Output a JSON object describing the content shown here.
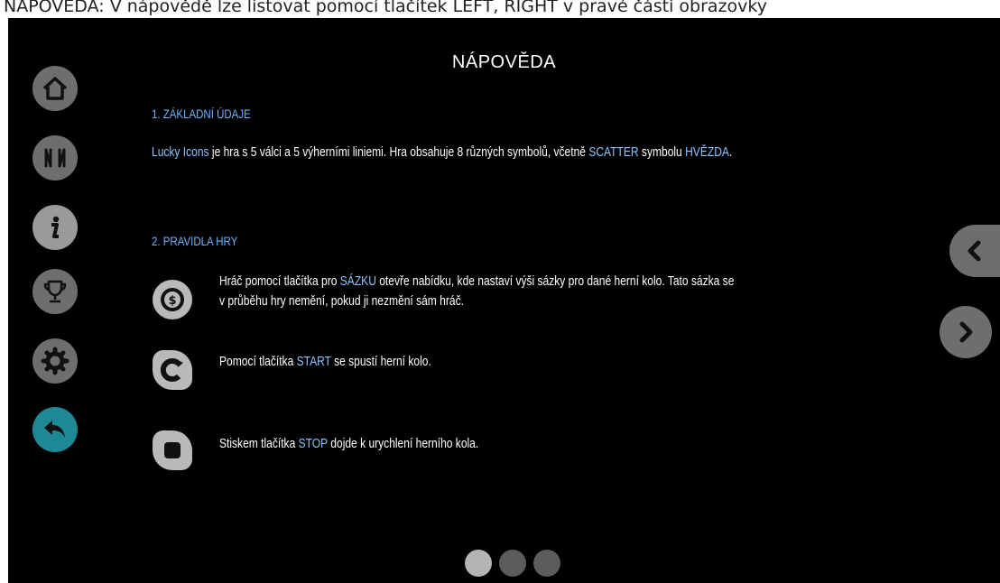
{
  "caption": "NÁPOVĚDA: V nápovědě lze listovat pomocí tlačítek LEFT, RIGHT v pravé části obrazovky",
  "sidebar": {
    "items": [
      {
        "name": "home",
        "icon": "home-icon"
      },
      {
        "name": "paytable",
        "icon": "paytable-icon"
      },
      {
        "name": "info",
        "icon": "info-icon"
      },
      {
        "name": "trophy",
        "icon": "trophy-icon"
      },
      {
        "name": "settings",
        "icon": "gear-icon"
      },
      {
        "name": "back",
        "icon": "back-arrow-icon",
        "active": true
      }
    ]
  },
  "help": {
    "title": "NÁPOVĚDA",
    "section1": {
      "heading": "1. ZÁKLADNÍ ÚDAJE",
      "p_game": "Lucky Icons",
      "p_a": " je hra s 5 válci a 5 výherními liniemi. Hra obsahuje 8 různých symbolů, včetně ",
      "p_scatter": "SCATTER",
      "p_b": " symbolu ",
      "p_star": "HVĚZDA",
      "p_end": "."
    },
    "section2": {
      "heading": "2. PRAVIDLA HRY",
      "rules": [
        {
          "icon": "coin-bet-icon",
          "a": "Hráč pomocí tlačítka pro ",
          "hl": "SÁZKU",
          "b": " otevře nabídku, kde nastaví výši sázky pro dané herní kolo. Tato sázka se",
          "line2": "v průběhu hry nemění, pokud ji nezmění sám hráč."
        },
        {
          "icon": "start-refresh-icon",
          "a": "Pomocí tlačítka ",
          "hl": "START",
          "b": " se spustí herní kolo."
        },
        {
          "icon": "stop-icon",
          "a": "Stiskem tlačítka ",
          "hl": "STOP",
          "b": " dojde k urychlení herního kola."
        }
      ]
    }
  },
  "nav": {
    "prev_icon": "chevron-left-icon",
    "next_icon": "chevron-right-icon"
  },
  "pagination": {
    "pages": 3,
    "current": 1
  },
  "colors": {
    "background": "#000000",
    "accent": "#1e8895",
    "highlight": "#8cc2ff",
    "heading": "#6fb2ff",
    "button": "#6e6e6e"
  }
}
